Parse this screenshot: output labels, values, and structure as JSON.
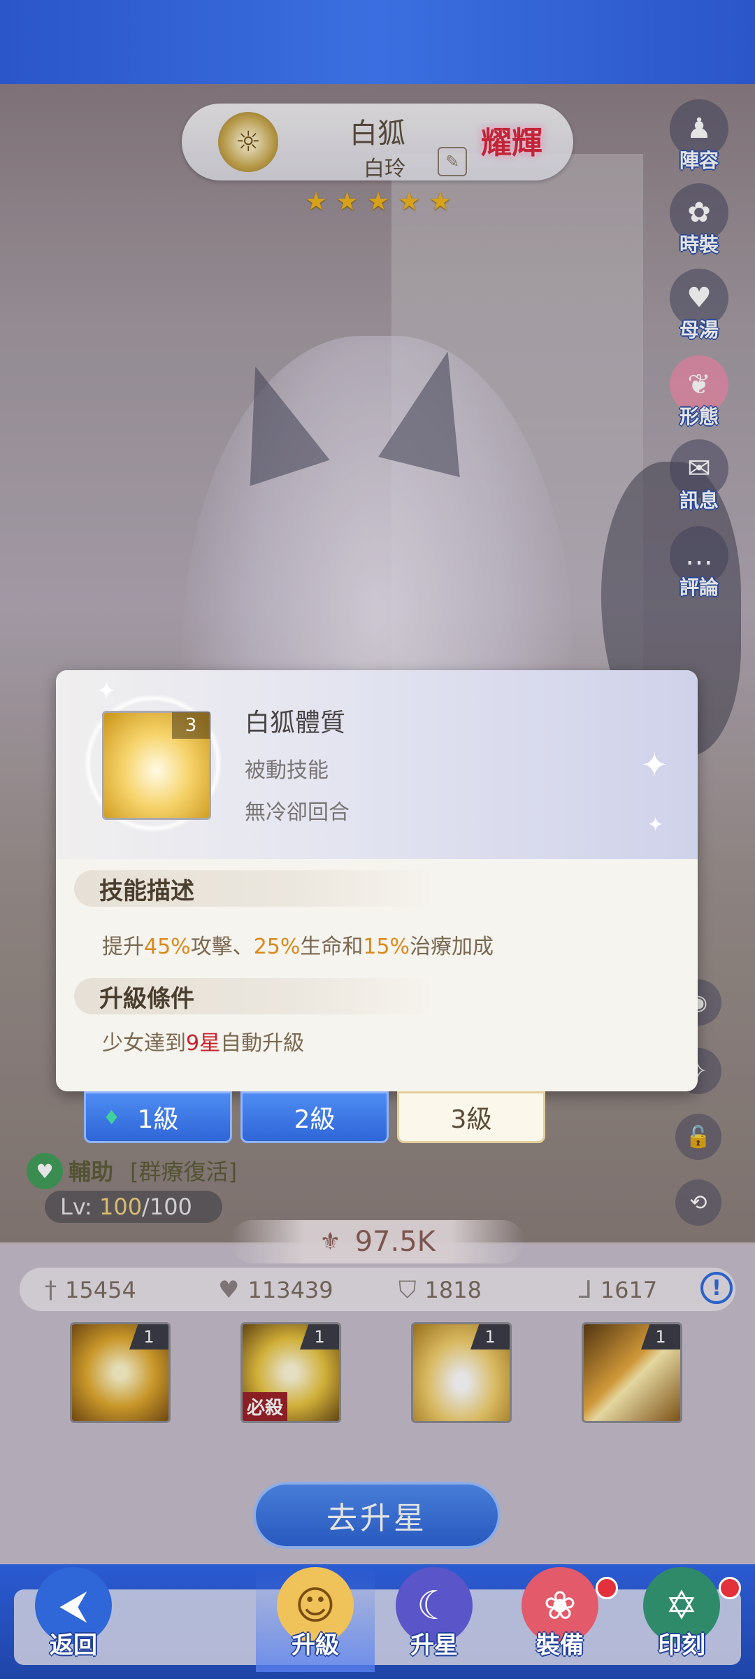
{
  "header": {
    "name": "白狐",
    "subname": "白玲",
    "rank_badge": "耀輝",
    "stars": [
      "★",
      "★",
      "★",
      "★",
      "★"
    ],
    "emblem_icon": "sun-emblem-icon",
    "rename_icon": "edit-icon"
  },
  "side_menu": [
    {
      "label": "陣容",
      "icon": "chess-piece-icon",
      "glyph": "♟"
    },
    {
      "label": "時裝",
      "icon": "outfit-icon",
      "glyph": "✿"
    },
    {
      "label": "母湯",
      "icon": "heart-icon",
      "glyph": "♥"
    },
    {
      "label": "形態",
      "icon": "form-icon",
      "glyph": "❦"
    },
    {
      "label": "訊息",
      "icon": "book-icon",
      "glyph": "✉"
    },
    {
      "label": "評論",
      "icon": "comment-icon",
      "glyph": "…"
    }
  ],
  "side_small": [
    {
      "icon": "camera-icon",
      "glyph": "◉"
    },
    {
      "icon": "filter-icon",
      "glyph": "✧"
    },
    {
      "icon": "lock-icon",
      "glyph": "🔓"
    },
    {
      "icon": "rotate-icon",
      "glyph": "⟲"
    }
  ],
  "modal": {
    "skill_name": "白狐體質",
    "skill_type": "被動技能",
    "skill_cd": "無冷卻回合",
    "skill_level": "3",
    "desc_title": "技能描述",
    "desc": {
      "p1": "提升",
      "v1": "45%",
      "p2": "攻擊、",
      "v2": "25%",
      "p3": "生命和",
      "v3": "15%",
      "p4": "治療加成"
    },
    "cond_title": "升級條件",
    "cond": {
      "p1": "少女達到",
      "v1": "9星",
      "p2": "自動升級"
    }
  },
  "level_tabs": [
    "1級",
    "2級",
    "3級"
  ],
  "role": {
    "label": "輔助",
    "tag": "[群療復活]"
  },
  "level": {
    "prefix": "Lv:",
    "current": "100",
    "max": "/100"
  },
  "power": "97.5K",
  "stats": [
    {
      "icon": "sword-icon",
      "glyph": "†",
      "value": "15454"
    },
    {
      "icon": "heart-icon",
      "glyph": "♥",
      "value": "113439"
    },
    {
      "icon": "shield-icon",
      "glyph": "⛉",
      "value": "1818"
    },
    {
      "icon": "boot-icon",
      "glyph": "ᒧ",
      "value": "1617"
    }
  ],
  "skill_slots": [
    {
      "level": "1",
      "tag": ""
    },
    {
      "level": "1",
      "tag": "必殺"
    },
    {
      "level": "1",
      "tag": ""
    },
    {
      "level": "1",
      "tag": ""
    }
  ],
  "upgrade_star_button": "去升星",
  "bottom_nav": [
    {
      "label": "返回",
      "icon": "back-arrow-icon",
      "glyph": "⮜"
    },
    {
      "label": "升級",
      "icon": "level-up-portrait-icon",
      "glyph": "☺"
    },
    {
      "label": "升星",
      "icon": "moon-star-icon",
      "glyph": "☾"
    },
    {
      "label": "裝備",
      "icon": "equipment-icon",
      "glyph": "❀"
    },
    {
      "label": "印刻",
      "icon": "hexagram-icon",
      "glyph": "✡"
    }
  ],
  "colors": {
    "accent_blue": "#2f66d8",
    "highlight_orange": "#d98a1c",
    "highlight_red": "#c8202a",
    "star_gold": "#f2b318"
  }
}
